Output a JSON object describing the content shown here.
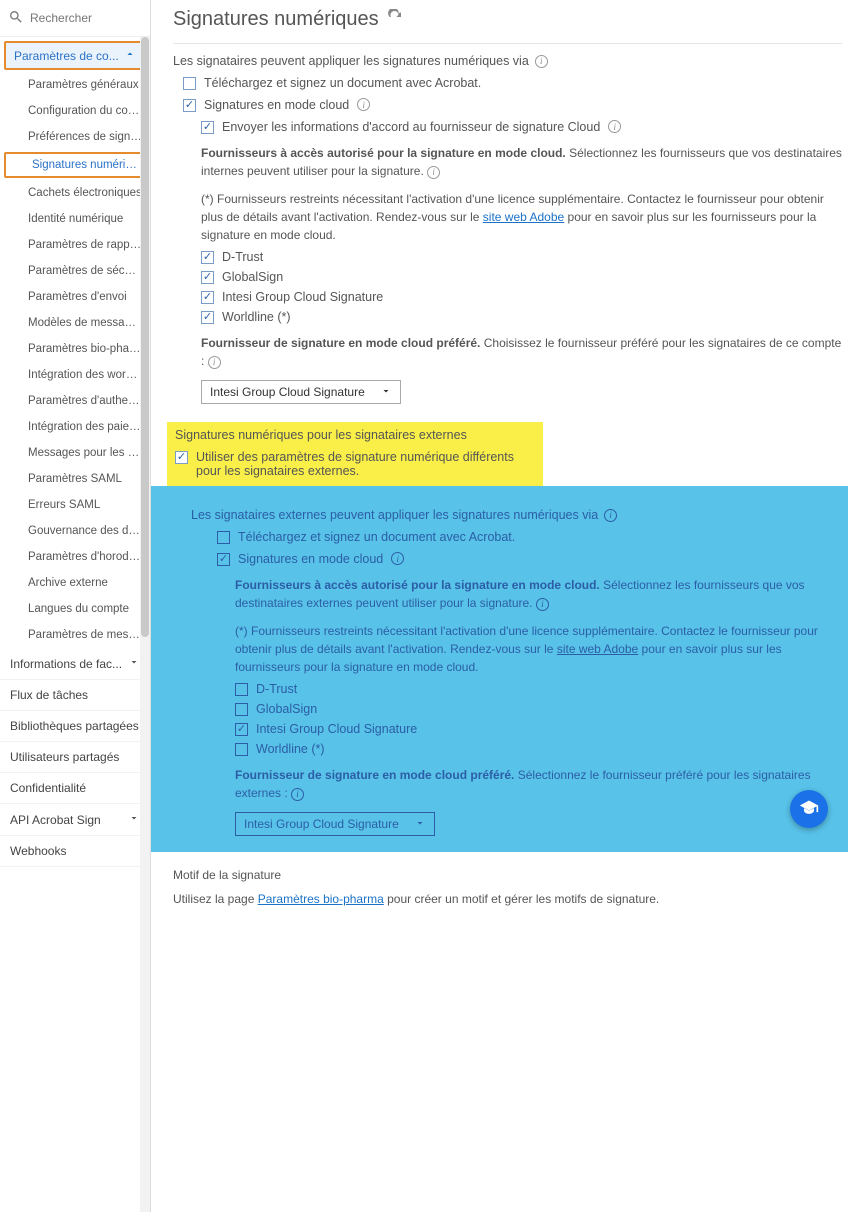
{
  "search": {
    "placeholder": "Rechercher"
  },
  "sidebar": {
    "top": {
      "label": "Paramètres de co..."
    },
    "items": [
      "Paramètres généraux",
      "Configuration du compte",
      "Préférences de signature",
      "Signatures numériques",
      "Cachets électroniques",
      "Identité numérique",
      "Paramètres de rapport",
      "Paramètres de sécurité",
      "Paramètres d'envoi",
      "Modèles de messages",
      "Paramètres bio-pharma",
      "Intégration des workflo...",
      "Paramètres d'authentifi...",
      "Intégration des paieme...",
      "Messages pour les sign...",
      "Paramètres SAML",
      "Erreurs SAML",
      "Gouvernance des donn...",
      "Paramètres d'horodatage",
      "Archive externe",
      "Langues du compte",
      "Paramètres de message..."
    ],
    "bottom": [
      {
        "label": "Informations de fac...",
        "hasChevron": true
      },
      {
        "label": "Flux de tâches",
        "hasChevron": false
      },
      {
        "label": "Bibliothèques partagées",
        "hasChevron": false
      },
      {
        "label": "Utilisateurs partagés",
        "hasChevron": false
      },
      {
        "label": "Confidentialité",
        "hasChevron": false
      },
      {
        "label": "API Acrobat Sign",
        "hasChevron": true
      },
      {
        "label": "Webhooks",
        "hasChevron": false
      }
    ]
  },
  "page": {
    "title": "Signatures numériques",
    "intro": "Les signataires peuvent appliquer les signatures numériques via",
    "opt_download": "Téléchargez et signez un document avec Acrobat.",
    "opt_cloud": "Signatures en mode cloud",
    "opt_send_info": "Envoyer les informations d'accord au fournisseur de signature Cloud",
    "providers_heading_bold": "Fournisseurs à accès autorisé pour la signature en mode cloud.",
    "providers_heading_tail": " Sélectionnez les fournisseurs que vos destinataires internes peuvent utiliser pour la signature.",
    "providers_note_pre": "(*) Fournisseurs restreints nécessitant l'activation d'une licence supplémentaire. Contactez le fournisseur pour obtenir plus de détails avant l'activation. Rendez-vous sur le ",
    "providers_note_link": "site web Adobe",
    "providers_note_post": " pour en savoir plus sur les fournisseurs pour la signature en mode cloud.",
    "providers": [
      "D-Trust",
      "GlobalSign",
      "Intesi Group Cloud Signature",
      "Worldline (*)"
    ],
    "preferred_label_bold": "Fournisseur de signature en mode cloud préféré.",
    "preferred_label_tail": " Choisissez le fournisseur préféré pour les signataires de ce compte :",
    "preferred_value": "Intesi Group Cloud Signature"
  },
  "yellow": {
    "title": "Signatures numériques pour les signataires externes",
    "checkbox": "Utiliser des paramètres de signature numérique différents pour les signataires externes."
  },
  "blue": {
    "intro": "Les signataires externes peuvent appliquer les signatures numériques via",
    "opt_download": "Téléchargez et signez un document avec Acrobat.",
    "opt_cloud": "Signatures en mode cloud",
    "providers_heading_bold": "Fournisseurs à accès autorisé pour la signature en mode cloud.",
    "providers_heading_tail": " Sélectionnez les fournisseurs que vos destinataires externes peuvent utiliser pour la signature.",
    "providers_note_pre": "(*) Fournisseurs restreints nécessitant l'activation d'une licence supplémentaire. Contactez le fournisseur pour obtenir plus de détails avant l'activation. Rendez-vous sur le ",
    "providers_note_link": "site web Adobe",
    "providers_note_post": " pour en savoir plus sur les fournisseurs pour la signature en mode cloud.",
    "providers": [
      "D-Trust",
      "GlobalSign",
      "Intesi Group Cloud Signature",
      "Worldline (*)"
    ],
    "preferred_label_bold": "Fournisseur de signature en mode cloud préféré.",
    "preferred_label_tail": " Sélectionnez le fournisseur préféré pour les signataires externes :",
    "preferred_value": "Intesi Group Cloud Signature"
  },
  "motif": {
    "title": "Motif de la signature",
    "pre": "Utilisez la page ",
    "link": "Paramètres bio-pharma",
    "post": " pour créer un motif et gérer les motifs de signature."
  }
}
